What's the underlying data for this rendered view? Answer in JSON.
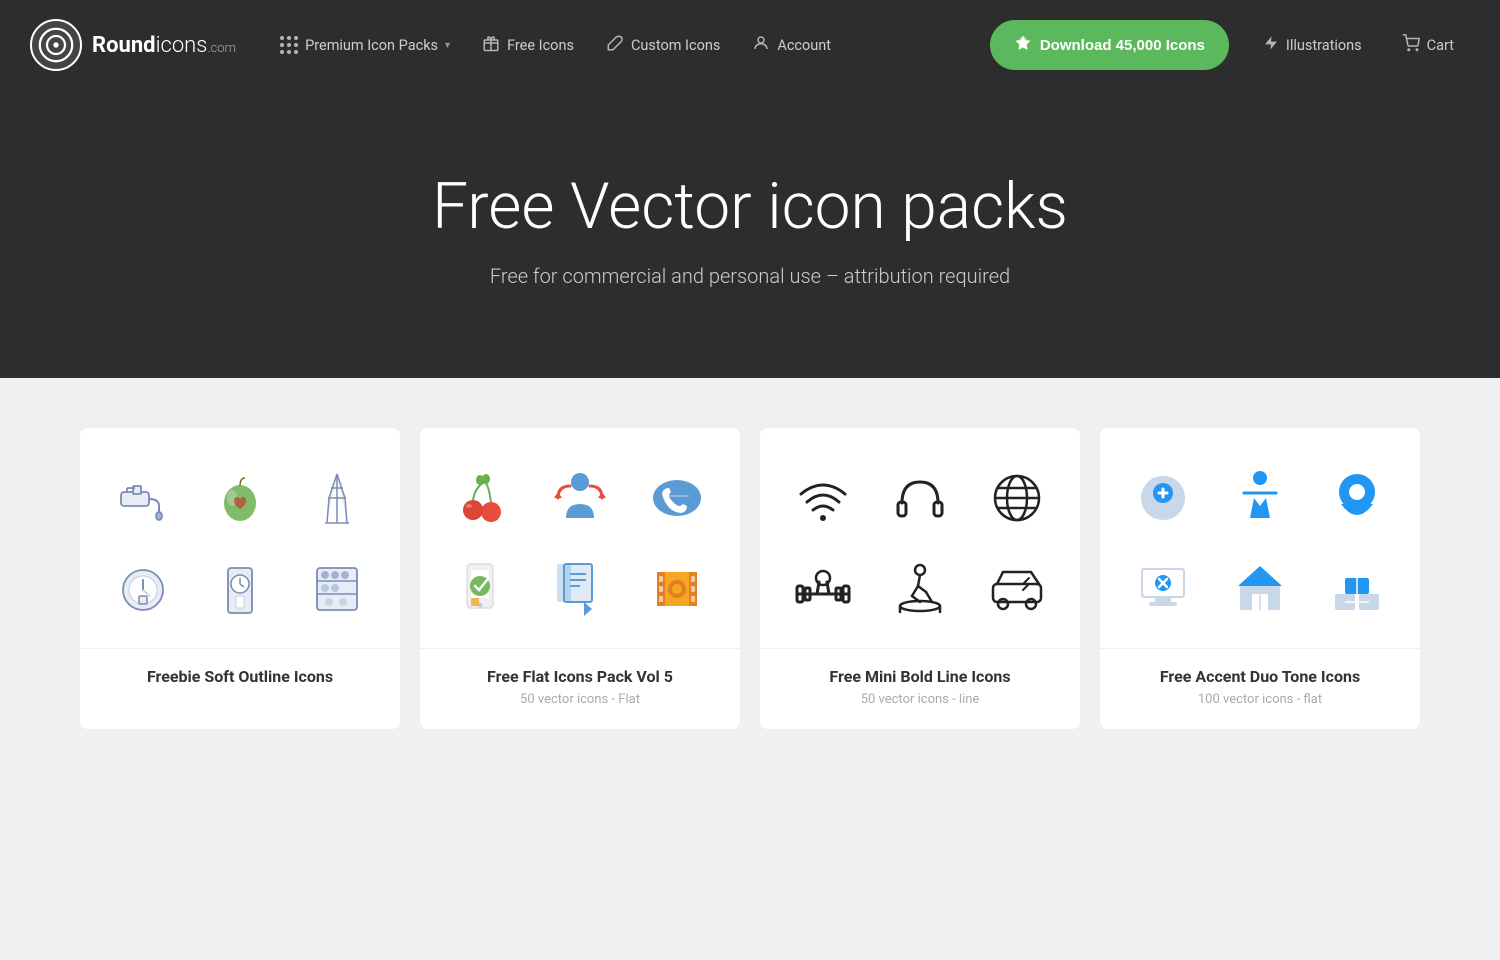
{
  "navbar": {
    "logo": {
      "brand": "Round",
      "brand2": "icons",
      "tld": ".com"
    },
    "items": [
      {
        "id": "premium",
        "label": "Premium Icon Packs",
        "has_chevron": true,
        "icon": "grid"
      },
      {
        "id": "free",
        "label": "Free Icons",
        "has_chevron": false,
        "icon": "gift"
      },
      {
        "id": "custom",
        "label": "Custom Icons",
        "has_chevron": false,
        "icon": "brush"
      },
      {
        "id": "account",
        "label": "Account",
        "has_chevron": false,
        "icon": "user"
      }
    ],
    "cta": {
      "label": "Download 45,000 Icons",
      "icon": "award"
    },
    "right_items": [
      {
        "id": "illustrations",
        "label": "Illustrations",
        "icon": "lightning"
      },
      {
        "id": "cart",
        "label": "Cart",
        "icon": "cart"
      }
    ]
  },
  "hero": {
    "title": "Free Vector icon packs",
    "subtitle": "Free for commercial and personal use – attribution required"
  },
  "cards": [
    {
      "id": "soft-outline",
      "title": "Freebie Soft Outline Icons",
      "meta": "",
      "style": "soft-outline"
    },
    {
      "id": "flat-vol5",
      "title": "Free Flat Icons Pack Vol 5",
      "meta": "50 vector icons - Flat",
      "style": "flat"
    },
    {
      "id": "mini-bold",
      "title": "Free Mini Bold Line Icons",
      "meta": "50 vector icons - line",
      "style": "line"
    },
    {
      "id": "accent-duo",
      "title": "Free Accent Duo Tone Icons",
      "meta": "100 vector icons - flat",
      "style": "duotone"
    }
  ]
}
